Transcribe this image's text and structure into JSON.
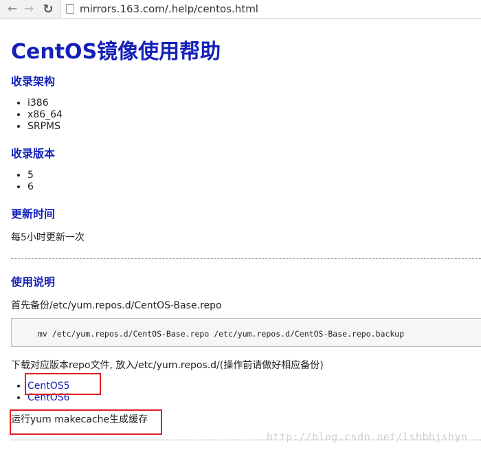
{
  "browser": {
    "url": "mirrors.163.com/.help/centos.html",
    "back_icon": "back-arrow-icon",
    "forward_icon": "forward-arrow-icon",
    "reload_icon": "reload-icon"
  },
  "page": {
    "title": "CentOS镜像使用帮助",
    "arch": {
      "heading": "收录架构",
      "items": [
        "i386",
        "x86_64",
        "SRPMS"
      ]
    },
    "versions": {
      "heading": "收录版本",
      "items": [
        "5",
        "6"
      ]
    },
    "update": {
      "heading": "更新时间",
      "text": "每5小时更新一次"
    },
    "usage": {
      "heading": "使用说明",
      "step1": "首先备份/etc/yum.repos.d/CentOS-Base.repo",
      "command": "mv /etc/yum.repos.d/CentOS-Base.repo /etc/yum.repos.d/CentOS-Base.repo.backup",
      "step2": "下载对应版本repo文件, 放入/etc/yum.repos.d/(操作前请做好相应备份)",
      "links": [
        "CentOS5",
        "CentOS6"
      ],
      "step3": "运行yum makecache生成缓存"
    }
  },
  "watermark": "http://blog.csdn.net/lshbhjshyn",
  "colors": {
    "heading": "#1420b8",
    "highlight_box": "#e02020"
  }
}
